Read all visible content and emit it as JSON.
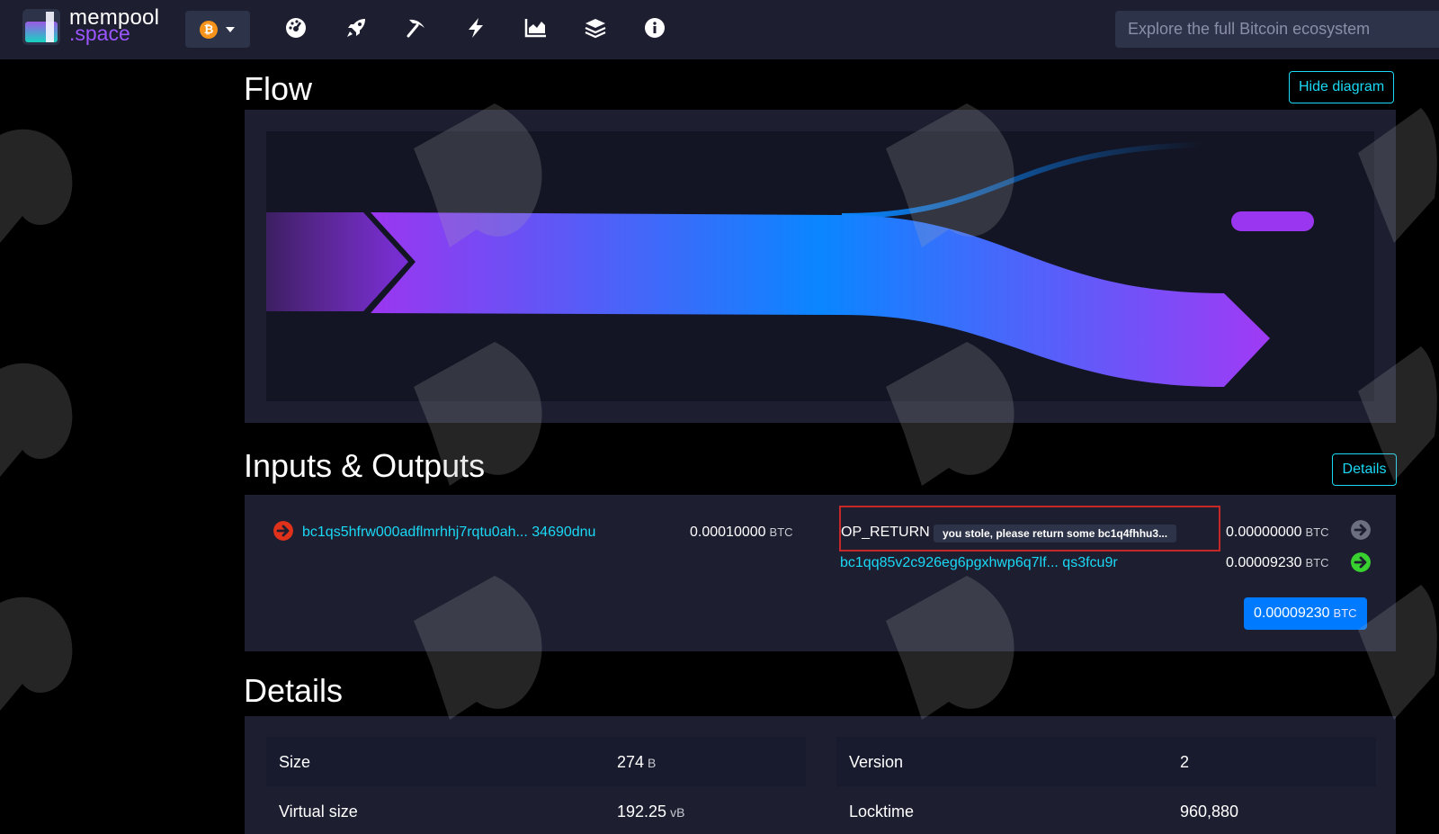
{
  "navbar": {
    "brand_top": "mempool",
    "brand_bottom": ".space",
    "network_symbol": "₿",
    "search_placeholder": "Explore the full Bitcoin ecosystem",
    "icons": [
      "dashboard-icon",
      "rocket-icon",
      "pickaxe-icon",
      "lightning-icon",
      "chart-icon",
      "layers-icon",
      "info-icon"
    ]
  },
  "flow": {
    "title": "Flow",
    "toggle_label": "Hide diagram"
  },
  "io": {
    "title": "Inputs & Outputs",
    "details_label": "Details",
    "inputs": [
      {
        "address": "bc1qs5hfrw000adflmrhhj7rqtu0ah... 34690dnu",
        "amount": "0.00010000",
        "unit": "BTC"
      }
    ],
    "outputs": [
      {
        "label": "OP_RETURN",
        "message": "you stole, please return some bc1q4fhhu3...",
        "amount": "0.00000000",
        "unit": "BTC"
      },
      {
        "address": "bc1qq85v2c926eg6pgxhwp6q7lf... qs3fcu9r",
        "amount": "0.00009230",
        "unit": "BTC"
      }
    ],
    "total": {
      "amount": "0.00009230",
      "unit": "BTC"
    }
  },
  "details": {
    "title": "Details",
    "left": [
      {
        "key": "Size",
        "value": "274",
        "unit": "B"
      },
      {
        "key": "Virtual size",
        "value": "192.25",
        "unit": "vB"
      }
    ],
    "right": [
      {
        "key": "Version",
        "value": "2"
      },
      {
        "key": "Locktime",
        "value": "960,880"
      }
    ]
  },
  "colors": {
    "accent": "#1bd8f4",
    "navbar_bg": "#1d1f31",
    "panel_bg": "#1d1f31",
    "flow_bg": "#131524",
    "purple": "#9b36f0",
    "blue": "#0a7fff",
    "op_return_border": "#c62828",
    "total_badge": "#007bff",
    "input_arrow": "#e0321b",
    "spent_arrow": "#6b6f80",
    "unspent_arrow": "#39d12f"
  }
}
